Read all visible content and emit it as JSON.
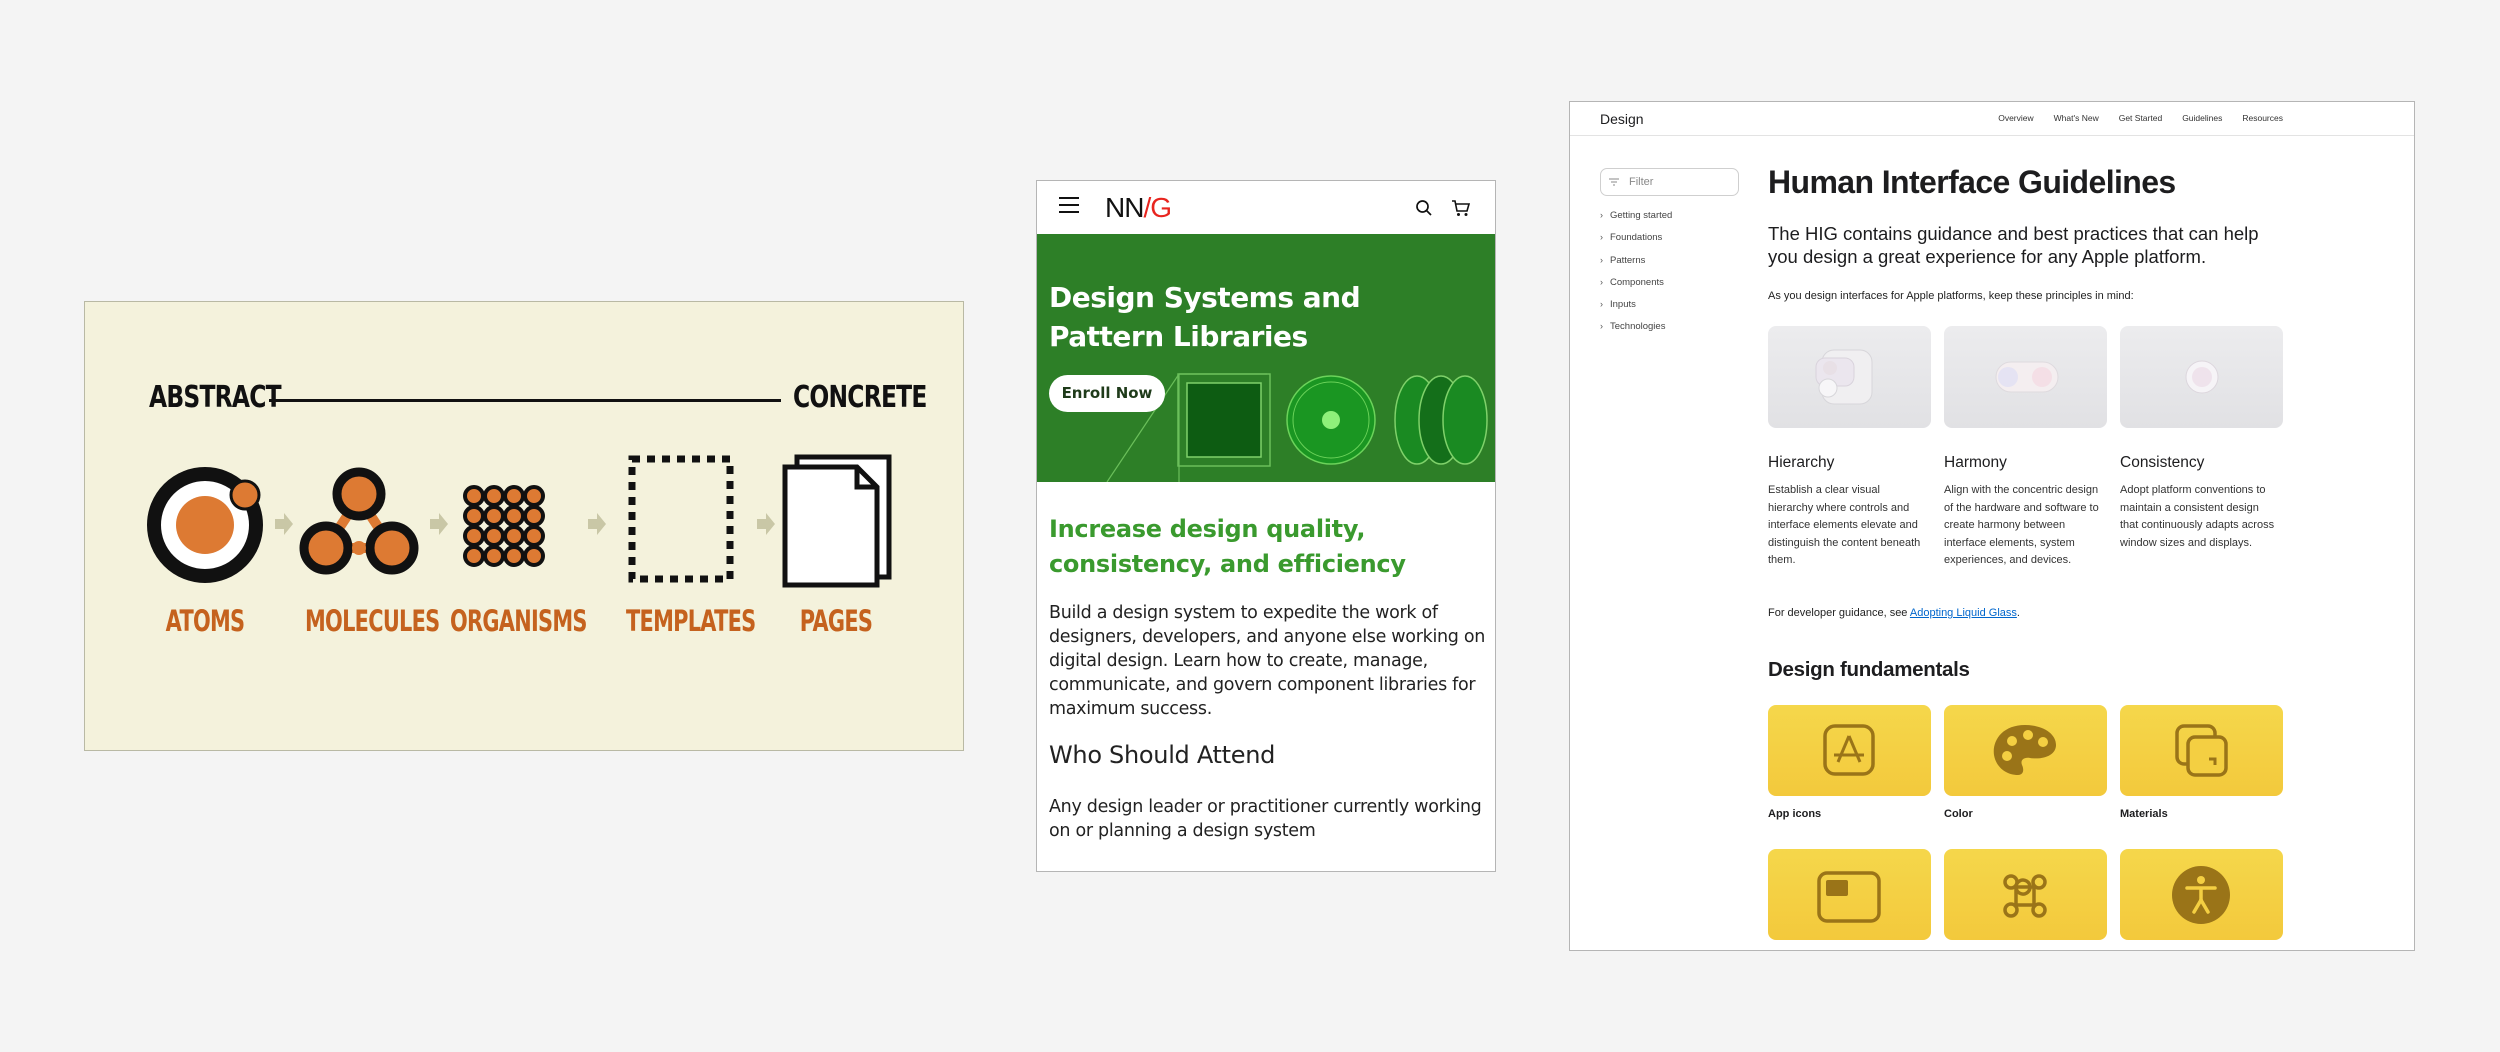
{
  "atomic": {
    "start_label": "ABSTRACT",
    "end_label": "CONCRETE",
    "stages": [
      "ATOMS",
      "MOLECULES",
      "ORGANISMS",
      "TEMPLATES",
      "PAGES"
    ],
    "colors": {
      "accent": "#dd7a33",
      "label": "#c5621e",
      "background": "#f4f2dc",
      "arrow": "#c9c7a6"
    }
  },
  "nng": {
    "logo": {
      "nn": "NN",
      "slash": "/",
      "g": "G"
    },
    "icons": [
      "menu-icon",
      "search-icon",
      "cart-icon"
    ],
    "hero_title": "Design Systems and Pattern Libraries",
    "enroll_label": "Enroll Now",
    "tagline": "Increase design quality, consistency, and efficiency",
    "description": "Build a design system to expedite the work of designers, developers, and anyone else working on digital design. Learn how to create, manage, communicate, and govern component libraries for maximum success.",
    "who_heading": "Who Should Attend",
    "who_text": "Any design leader or practitioner currently working on or planning a design system",
    "colors": {
      "hero": "#2d7f27",
      "tagline": "#3a9a2e",
      "logo_accent": "#e8251f"
    }
  },
  "hig": {
    "brand": "Design",
    "nav": [
      "Overview",
      "What's New",
      "Get Started",
      "Guidelines",
      "Resources"
    ],
    "filter_placeholder": "Filter",
    "sidebar": [
      "Getting started",
      "Foundations",
      "Patterns",
      "Components",
      "Inputs",
      "Technologies"
    ],
    "title": "Human Interface Guidelines",
    "lead": "The HIG contains guidance and best practices that can help you design a great experience for any Apple platform.",
    "intro": "As you design interfaces for Apple platforms, keep these principles in mind:",
    "principles": [
      {
        "title": "Hierarchy",
        "text": "Establish a clear visual hierarchy where controls and interface elements elevate and distinguish the content beneath them."
      },
      {
        "title": "Harmony",
        "text": "Align with the concentric design of the hardware and software to create harmony between interface elements, system experiences, and devices."
      },
      {
        "title": "Consistency",
        "text": "Adopt platform conventions to maintain a consistent design that continuously adapts across window sizes and displays."
      }
    ],
    "developer_prefix": "For developer guidance, see ",
    "developer_link": "Adopting Liquid Glass",
    "developer_suffix": ".",
    "fundamentals_heading": "Design fundamentals",
    "fundamentals": [
      "App icons",
      "Color",
      "Materials"
    ],
    "colors": {
      "link": "#0066cc",
      "tile": "#f4cf42",
      "tile_icon": "#9a7418"
    }
  }
}
